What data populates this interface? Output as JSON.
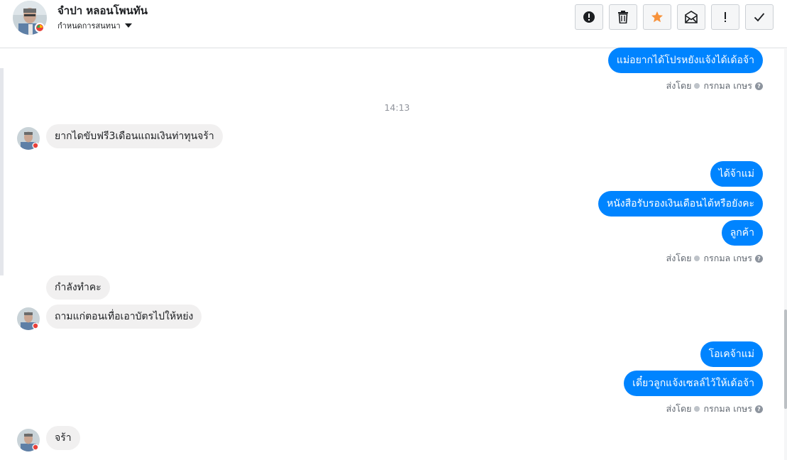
{
  "header": {
    "name": "จำปา หลอนโพนทัน",
    "subtitle": "กำหนดการสนทนา",
    "avatar_icon": "avatar-photo"
  },
  "toolbar": [
    {
      "name": "report-spam-button",
      "icon": "exclamation-circle-icon"
    },
    {
      "name": "delete-button",
      "icon": "trash-icon"
    },
    {
      "name": "star-button",
      "icon": "star-icon",
      "color": "#f7923b"
    },
    {
      "name": "mark-unread-button",
      "icon": "envelope-icon"
    },
    {
      "name": "follow-up-button",
      "icon": "exclamation-icon"
    },
    {
      "name": "mark-done-button",
      "icon": "check-icon"
    }
  ],
  "sent_by": {
    "label": "ส่งโดย",
    "agent": "กรกมล เกษร",
    "help": "?"
  },
  "timestamp": "14:13",
  "messages": [
    {
      "dir": "out",
      "text": "แม่อยากได้โปรหยังแจ้งได้เด้อจ้า"
    },
    {
      "dir": "in",
      "text": "ยากไดขับฟรี3เดือนแถมเงินท่าทุนจร้า"
    },
    {
      "dir": "out",
      "text": "ได้จ้าแม่"
    },
    {
      "dir": "out",
      "text": "หนังสือรับรองเงินเดือนได้หรือยังคะ"
    },
    {
      "dir": "out",
      "text": "ลูกค้า"
    },
    {
      "dir": "in",
      "text": "กำลังทำคะ"
    },
    {
      "dir": "in",
      "text": "ถามแก่ตอนเทื่อเอาบัตรไปให้หย่ง"
    },
    {
      "dir": "out",
      "text": "โอเคจ้าแม่"
    },
    {
      "dir": "out",
      "text": "เดี๋ยวลูกแจ้งเซลล์ไว้ให้เด้อจ้า"
    },
    {
      "dir": "in",
      "text": "จร้า"
    }
  ],
  "colors": {
    "outgoing": "#0084ff",
    "incoming": "#f1f0f0",
    "accent_star": "#f7923b"
  }
}
